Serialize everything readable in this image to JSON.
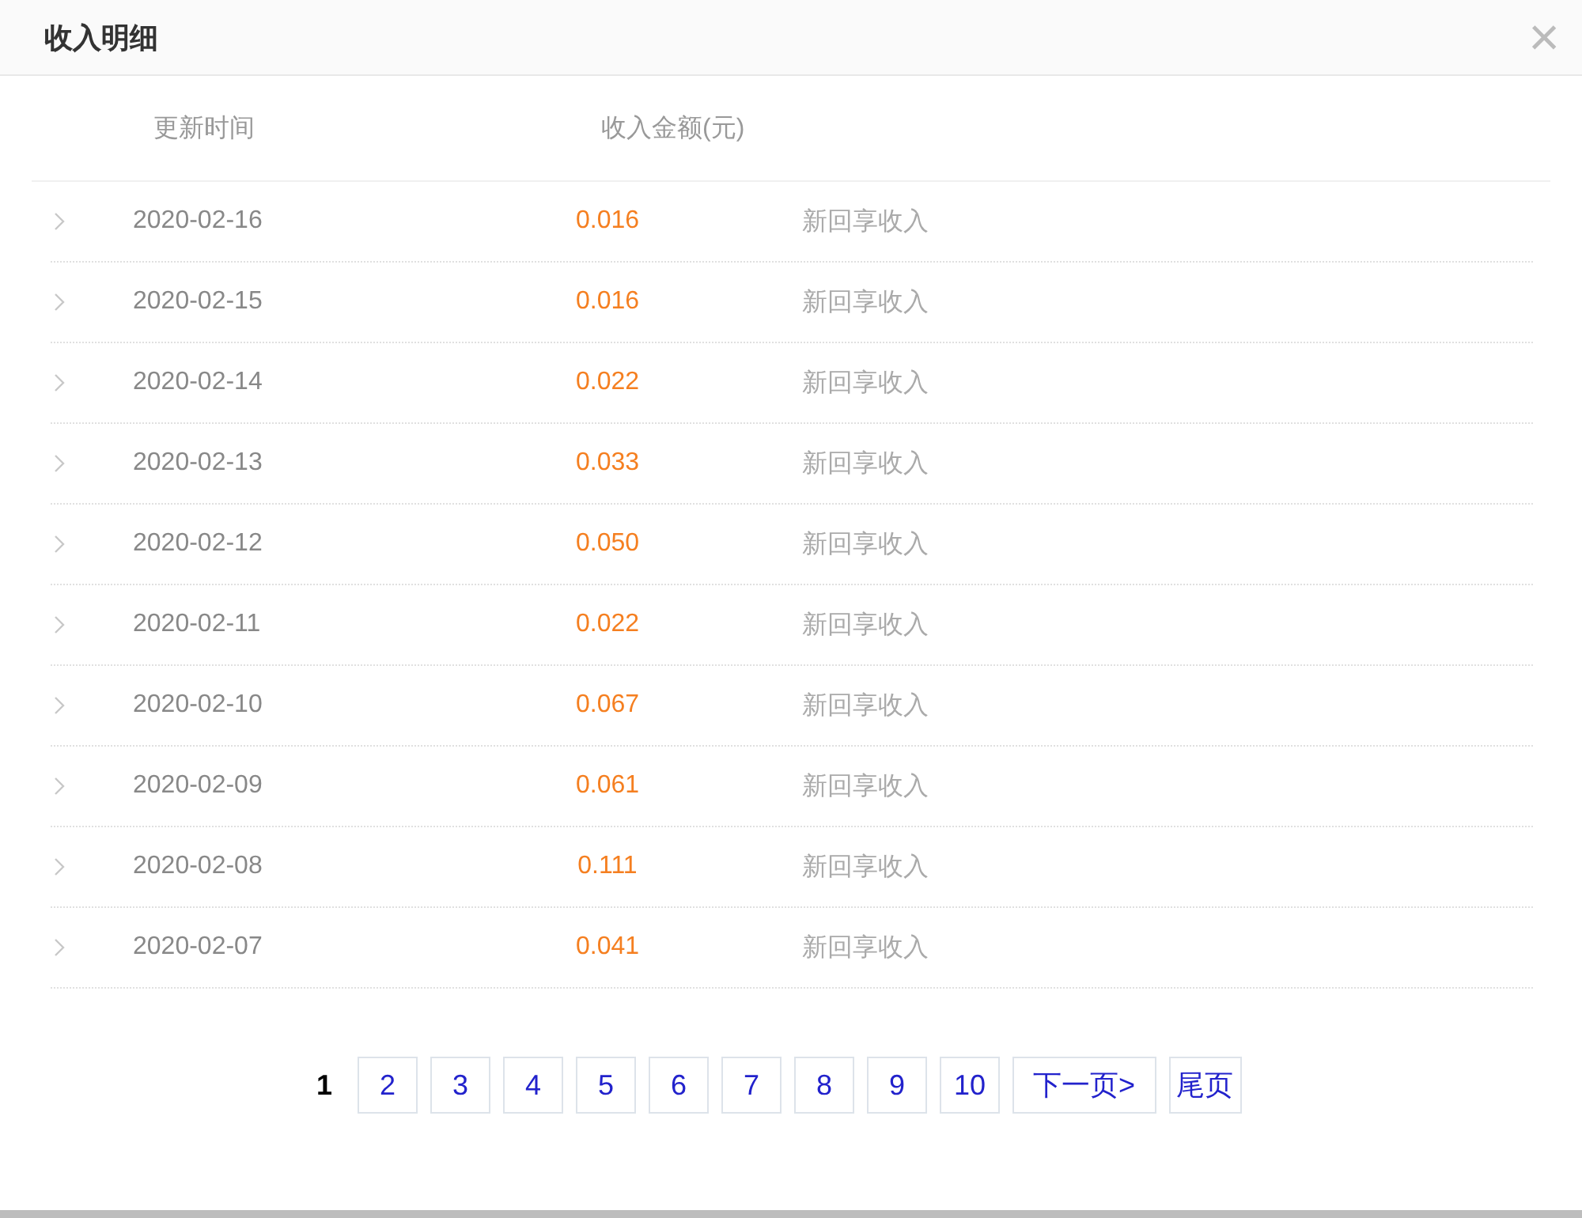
{
  "window": {
    "title": "收入明细",
    "close": "×"
  },
  "table": {
    "columns": [
      "更新时间",
      "收入金额(元)"
    ],
    "rows": [
      {
        "date": "2020-02-16",
        "amount": "0.016",
        "type": "新回享收入"
      },
      {
        "date": "2020-02-15",
        "amount": "0.016",
        "type": "新回享收入"
      },
      {
        "date": "2020-02-14",
        "amount": "0.022",
        "type": "新回享收入"
      },
      {
        "date": "2020-02-13",
        "amount": "0.033",
        "type": "新回享收入"
      },
      {
        "date": "2020-02-12",
        "amount": "0.050",
        "type": "新回享收入"
      },
      {
        "date": "2020-02-11",
        "amount": "0.022",
        "type": "新回享收入"
      },
      {
        "date": "2020-02-10",
        "amount": "0.067",
        "type": "新回享收入"
      },
      {
        "date": "2020-02-09",
        "amount": "0.061",
        "type": "新回享收入"
      },
      {
        "date": "2020-02-08",
        "amount": "0.111",
        "type": "新回享收入"
      },
      {
        "date": "2020-02-07",
        "amount": "0.041",
        "type": "新回享收入"
      }
    ]
  },
  "pagination": {
    "pages": [
      {
        "label": "1",
        "selected": true
      },
      {
        "label": "2",
        "selected": false
      },
      {
        "label": "3",
        "selected": false
      },
      {
        "label": "4",
        "selected": false
      },
      {
        "label": "5",
        "selected": false
      },
      {
        "label": "6",
        "selected": false
      },
      {
        "label": "7",
        "selected": false
      },
      {
        "label": "8",
        "selected": false
      },
      {
        "label": "9",
        "selected": false
      },
      {
        "label": "10",
        "selected": false
      }
    ],
    "next": "下一页>",
    "last": "尾页"
  }
}
